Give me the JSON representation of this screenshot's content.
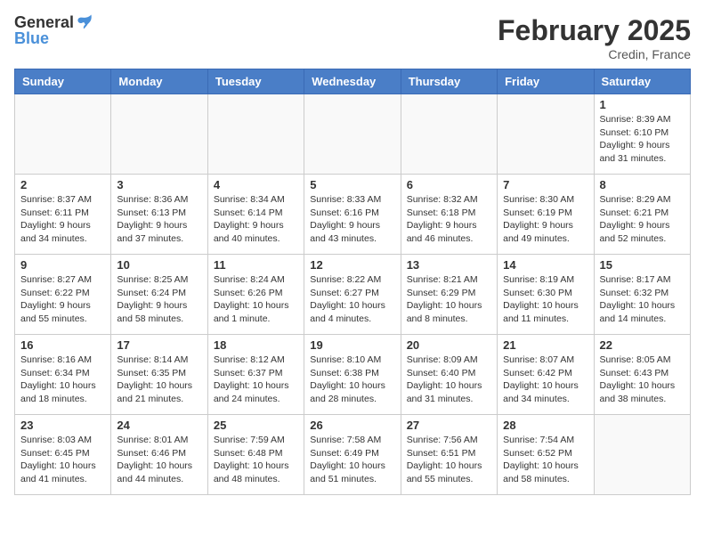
{
  "header": {
    "logo_general": "General",
    "logo_blue": "Blue",
    "month_year": "February 2025",
    "location": "Credin, France"
  },
  "weekdays": [
    "Sunday",
    "Monday",
    "Tuesday",
    "Wednesday",
    "Thursday",
    "Friday",
    "Saturday"
  ],
  "weeks": [
    [
      {
        "day": "",
        "info": ""
      },
      {
        "day": "",
        "info": ""
      },
      {
        "day": "",
        "info": ""
      },
      {
        "day": "",
        "info": ""
      },
      {
        "day": "",
        "info": ""
      },
      {
        "day": "",
        "info": ""
      },
      {
        "day": "1",
        "info": "Sunrise: 8:39 AM\nSunset: 6:10 PM\nDaylight: 9 hours and 31 minutes."
      }
    ],
    [
      {
        "day": "2",
        "info": "Sunrise: 8:37 AM\nSunset: 6:11 PM\nDaylight: 9 hours and 34 minutes."
      },
      {
        "day": "3",
        "info": "Sunrise: 8:36 AM\nSunset: 6:13 PM\nDaylight: 9 hours and 37 minutes."
      },
      {
        "day": "4",
        "info": "Sunrise: 8:34 AM\nSunset: 6:14 PM\nDaylight: 9 hours and 40 minutes."
      },
      {
        "day": "5",
        "info": "Sunrise: 8:33 AM\nSunset: 6:16 PM\nDaylight: 9 hours and 43 minutes."
      },
      {
        "day": "6",
        "info": "Sunrise: 8:32 AM\nSunset: 6:18 PM\nDaylight: 9 hours and 46 minutes."
      },
      {
        "day": "7",
        "info": "Sunrise: 8:30 AM\nSunset: 6:19 PM\nDaylight: 9 hours and 49 minutes."
      },
      {
        "day": "8",
        "info": "Sunrise: 8:29 AM\nSunset: 6:21 PM\nDaylight: 9 hours and 52 minutes."
      }
    ],
    [
      {
        "day": "9",
        "info": "Sunrise: 8:27 AM\nSunset: 6:22 PM\nDaylight: 9 hours and 55 minutes."
      },
      {
        "day": "10",
        "info": "Sunrise: 8:25 AM\nSunset: 6:24 PM\nDaylight: 9 hours and 58 minutes."
      },
      {
        "day": "11",
        "info": "Sunrise: 8:24 AM\nSunset: 6:26 PM\nDaylight: 10 hours and 1 minute."
      },
      {
        "day": "12",
        "info": "Sunrise: 8:22 AM\nSunset: 6:27 PM\nDaylight: 10 hours and 4 minutes."
      },
      {
        "day": "13",
        "info": "Sunrise: 8:21 AM\nSunset: 6:29 PM\nDaylight: 10 hours and 8 minutes."
      },
      {
        "day": "14",
        "info": "Sunrise: 8:19 AM\nSunset: 6:30 PM\nDaylight: 10 hours and 11 minutes."
      },
      {
        "day": "15",
        "info": "Sunrise: 8:17 AM\nSunset: 6:32 PM\nDaylight: 10 hours and 14 minutes."
      }
    ],
    [
      {
        "day": "16",
        "info": "Sunrise: 8:16 AM\nSunset: 6:34 PM\nDaylight: 10 hours and 18 minutes."
      },
      {
        "day": "17",
        "info": "Sunrise: 8:14 AM\nSunset: 6:35 PM\nDaylight: 10 hours and 21 minutes."
      },
      {
        "day": "18",
        "info": "Sunrise: 8:12 AM\nSunset: 6:37 PM\nDaylight: 10 hours and 24 minutes."
      },
      {
        "day": "19",
        "info": "Sunrise: 8:10 AM\nSunset: 6:38 PM\nDaylight: 10 hours and 28 minutes."
      },
      {
        "day": "20",
        "info": "Sunrise: 8:09 AM\nSunset: 6:40 PM\nDaylight: 10 hours and 31 minutes."
      },
      {
        "day": "21",
        "info": "Sunrise: 8:07 AM\nSunset: 6:42 PM\nDaylight: 10 hours and 34 minutes."
      },
      {
        "day": "22",
        "info": "Sunrise: 8:05 AM\nSunset: 6:43 PM\nDaylight: 10 hours and 38 minutes."
      }
    ],
    [
      {
        "day": "23",
        "info": "Sunrise: 8:03 AM\nSunset: 6:45 PM\nDaylight: 10 hours and 41 minutes."
      },
      {
        "day": "24",
        "info": "Sunrise: 8:01 AM\nSunset: 6:46 PM\nDaylight: 10 hours and 44 minutes."
      },
      {
        "day": "25",
        "info": "Sunrise: 7:59 AM\nSunset: 6:48 PM\nDaylight: 10 hours and 48 minutes."
      },
      {
        "day": "26",
        "info": "Sunrise: 7:58 AM\nSunset: 6:49 PM\nDaylight: 10 hours and 51 minutes."
      },
      {
        "day": "27",
        "info": "Sunrise: 7:56 AM\nSunset: 6:51 PM\nDaylight: 10 hours and 55 minutes."
      },
      {
        "day": "28",
        "info": "Sunrise: 7:54 AM\nSunset: 6:52 PM\nDaylight: 10 hours and 58 minutes."
      },
      {
        "day": "",
        "info": ""
      }
    ]
  ]
}
